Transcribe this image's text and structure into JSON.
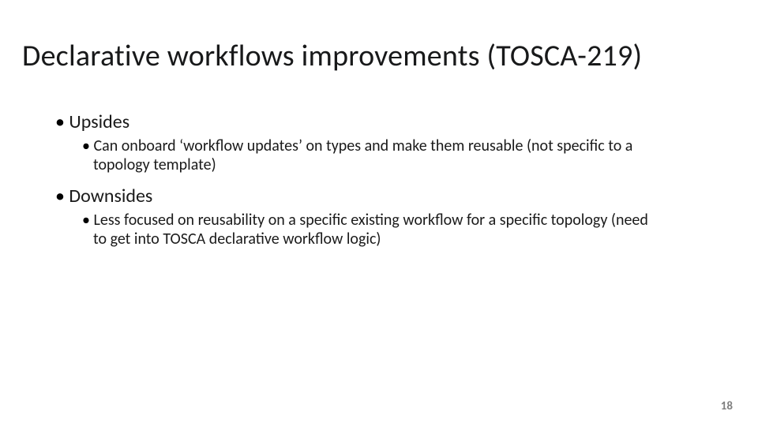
{
  "slide": {
    "title": "Declarative workflows improvements (TOSCA-219)",
    "sections": [
      {
        "heading": "Upsides",
        "items": [
          "Can onboard ‘workflow updates’ on types and make them reusable (not specific to a topology template)"
        ]
      },
      {
        "heading": "Downsides",
        "items": [
          "Less focused on reusability on a specific existing workflow for a specific topology (need to get into TOSCA declarative workflow logic)"
        ]
      }
    ],
    "page_number": "18"
  }
}
